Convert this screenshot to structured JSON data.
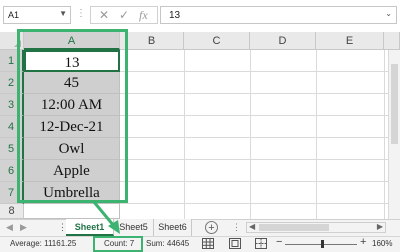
{
  "formula_bar": {
    "name_box": "A1",
    "dots": "⋮",
    "cancel_symbol": "✕",
    "enter_symbol": "✓",
    "fx_symbol": "fx",
    "content": "13"
  },
  "grid": {
    "corner": "",
    "columns": [
      "A",
      "B",
      "C",
      "D",
      "E"
    ],
    "rows": [
      "1",
      "2",
      "3",
      "4",
      "5",
      "6",
      "7",
      "8"
    ],
    "column_a_values": [
      "13",
      "45",
      "12:00 AM",
      "12-Dec-21",
      "Owl",
      "Apple",
      "Umbrella",
      ""
    ]
  },
  "sheet_tabs": {
    "nav_prev": "◀",
    "nav_next": "▶",
    "tabs": [
      "Sheet1",
      "Sheet5",
      "Sheet6"
    ],
    "active_tab": "Sheet1",
    "add_symbol": "+",
    "more_symbol": "⋮"
  },
  "status_bar": {
    "average": "Average: 11161.25",
    "count": "Count: 7",
    "sum": "Sum: 44645",
    "zoom_minus": "−",
    "zoom_plus": "+",
    "zoom_level": "160%"
  },
  "colors": {
    "accent_green": "#217346",
    "highlight_green": "#3cb371",
    "selection_gray": "#cfcfcf"
  },
  "icons": [
    "dropdown-icon",
    "cancel-icon",
    "enter-icon",
    "fx-icon",
    "add-sheet-icon",
    "normal-view-icon",
    "page-layout-icon",
    "page-break-icon"
  ]
}
